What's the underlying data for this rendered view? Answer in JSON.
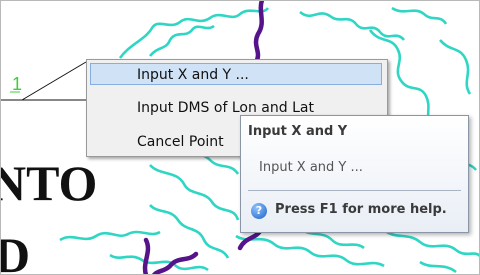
{
  "map": {
    "point_label": "1",
    "place_text_1": "NTO",
    "place_text_2": "D"
  },
  "context_menu": {
    "items": [
      {
        "label": "Input X and Y ...",
        "highlighted": true
      },
      {
        "label": "Input DMS of Lon and Lat"
      },
      {
        "label": "Cancel Point"
      }
    ]
  },
  "tooltip": {
    "title": "Input X and Y",
    "body": "Input X and Y ...",
    "help": "Press F1 for more help.",
    "help_icon": "help-icon"
  },
  "colors": {
    "contour": "#2fd6c4",
    "river": "#55148a",
    "highlight": "#cfe2f6",
    "label_green": "#3ccf3c"
  }
}
